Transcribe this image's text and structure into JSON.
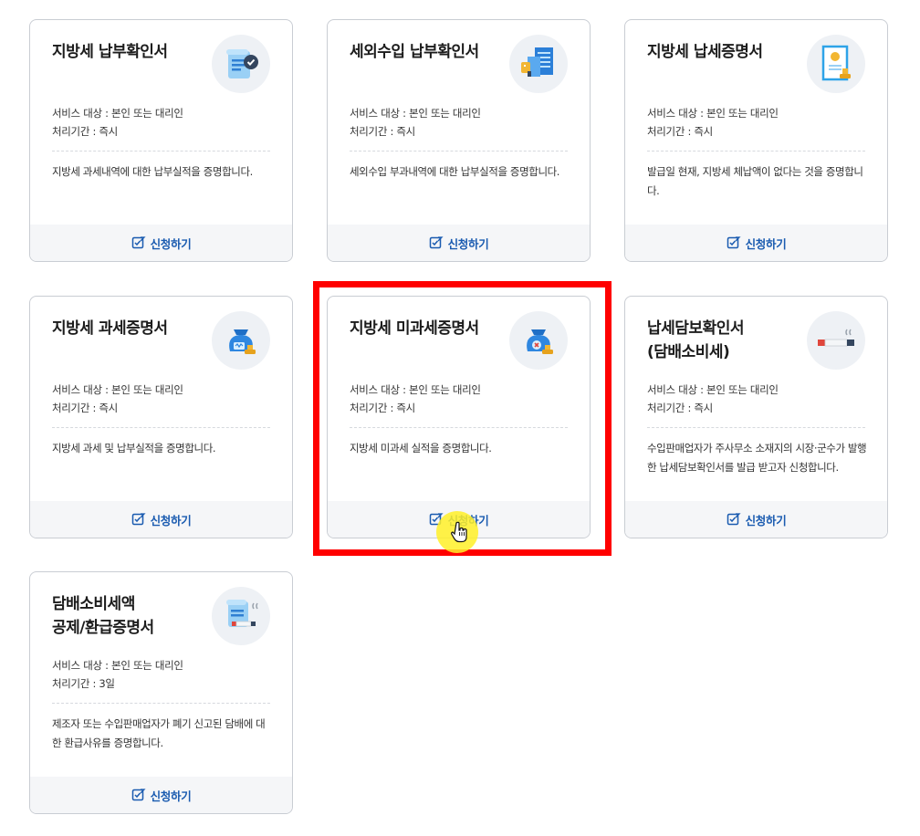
{
  "colors": {
    "accent": "#1a5bb0",
    "highlight": "#ff0000",
    "cursor_glow": "#fff028"
  },
  "cards": [
    {
      "title": "지방세 납부확인서",
      "icon": "scroll-check-icon",
      "target": "서비스 대상 : 본인 또는 대리인",
      "period": "처리기간 : 즉시",
      "description": "지방세 과세내역에 대한 납부실적을 증명합니다.",
      "apply_label": "신청하기"
    },
    {
      "title": "세외수입 납부확인서",
      "icon": "building-document-icon",
      "target": "서비스 대상 : 본인 또는 대리인",
      "period": "처리기간 : 즉시",
      "description": "세외수입 부과내역에 대한 납부실적을 증명합니다.",
      "apply_label": "신청하기"
    },
    {
      "title": "지방세 납세증명서",
      "icon": "certificate-stamp-icon",
      "target": "서비스 대상 : 본인 또는 대리인",
      "period": "처리기간 : 즉시",
      "description": "발급일 현재, 지방세 체납액이 없다는 것을 증명합니다.",
      "apply_label": "신청하기"
    },
    {
      "title": "지방세 과세증명서",
      "icon": "money-bag-stamp-icon",
      "target": "서비스 대상 : 본인 또는 대리인",
      "period": "처리기간 : 즉시",
      "description": "지방세 과세 및 납부실적을 증명합니다.",
      "apply_label": "신청하기"
    },
    {
      "title": "지방세 미과세증명서",
      "icon": "money-bag-x-icon",
      "target": "서비스 대상 : 본인 또는 대리인",
      "period": "처리기간 : 즉시",
      "description": "지방세 미과세 실적을 증명합니다.",
      "apply_label": "신청하기"
    },
    {
      "title": "납세담보확인서\n(담배소비세)",
      "icon": "cigarette-icon",
      "target": "서비스 대상 : 본인 또는 대리인",
      "period": "처리기간 : 즉시",
      "description": "수입판매업자가 주사무소 소재지의 시장·군수가 발행한 납세담보확인서를 발급 받고자 신청합니다.",
      "apply_label": "신청하기"
    },
    {
      "title": "담배소비세액\n공제/환급증명서",
      "icon": "scroll-cigarette-icon",
      "target": "서비스 대상 : 본인 또는 대리인",
      "period": "처리기간 : 3일",
      "description": "제조자 또는 수입판매업자가 폐기 신고된 담배에 대한 환급사유를 증명합니다.",
      "apply_label": "신청하기"
    }
  ]
}
